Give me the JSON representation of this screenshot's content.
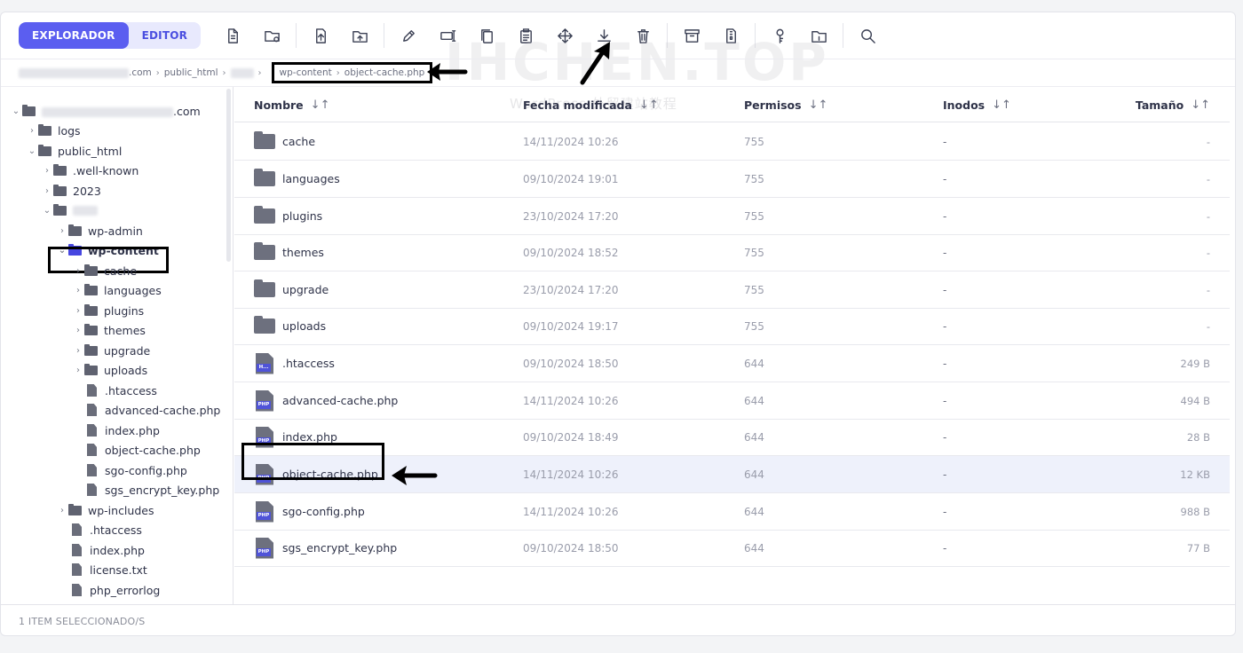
{
  "toolbar": {
    "explorer_label": "EXPLORADOR",
    "editor_label": "EDITOR",
    "tools": [
      "new-file-icon",
      "new-folder-icon",
      "upload-file-icon",
      "upload-folder-icon",
      "edit-icon",
      "rename-icon",
      "copy-icon",
      "paste-icon",
      "move-icon",
      "download-icon",
      "trash-icon",
      "archive-icon",
      "extract-icon",
      "permissions-icon",
      "folder-info-icon",
      "search-icon"
    ]
  },
  "breadcrumb": {
    "domain_suffix": ".com",
    "public_html": "public_html",
    "wp_content": "wp-content",
    "file": "object-cache.php"
  },
  "sidebar": {
    "root_suffix": ".com",
    "logs": "logs",
    "public_html": "public_html",
    "well_known": ".well-known",
    "y2023": "2023",
    "wp_admin": "wp-admin",
    "wp_content": "wp-content",
    "cache": "cache",
    "languages": "languages",
    "plugins": "plugins",
    "themes": "themes",
    "upgrade": "upgrade",
    "uploads": "uploads",
    "htaccess": ".htaccess",
    "advanced_cache": "advanced-cache.php",
    "index": "index.php",
    "object_cache": "object-cache.php",
    "sgo_config": "sgo-config.php",
    "sgs_key": "sgs_encrypt_key.php",
    "wp_includes": "wp-includes",
    "htaccess2": ".htaccess",
    "index2": "index.php",
    "license": "license.txt",
    "php_errorlog": "php_errorlog"
  },
  "table": {
    "headers": {
      "name": "Nombre",
      "date": "Fecha modificada",
      "perm": "Permisos",
      "inodes": "Inodos",
      "size": "Tamaño"
    },
    "rows": [
      {
        "name": "cache",
        "date": "14/11/2024 10:26",
        "perm": "755",
        "inodes": "-",
        "size": "-"
      },
      {
        "name": "languages",
        "date": "09/10/2024 19:01",
        "perm": "755",
        "inodes": "-",
        "size": "-"
      },
      {
        "name": "plugins",
        "date": "23/10/2024 17:20",
        "perm": "755",
        "inodes": "-",
        "size": "-"
      },
      {
        "name": "themes",
        "date": "09/10/2024 18:52",
        "perm": "755",
        "inodes": "-",
        "size": "-"
      },
      {
        "name": "upgrade",
        "date": "23/10/2024 17:20",
        "perm": "755",
        "inodes": "-",
        "size": "-"
      },
      {
        "name": "uploads",
        "date": "09/10/2024 19:17",
        "perm": "755",
        "inodes": "-",
        "size": "-"
      },
      {
        "name": ".htaccess",
        "tag": "H...",
        "date": "09/10/2024 18:50",
        "perm": "644",
        "inodes": "-",
        "size": "249 B"
      },
      {
        "name": "advanced-cache.php",
        "tag": "PHP",
        "date": "14/11/2024 10:26",
        "perm": "644",
        "inodes": "-",
        "size": "494 B"
      },
      {
        "name": "index.php",
        "tag": "PHP",
        "date": "09/10/2024 18:49",
        "perm": "644",
        "inodes": "-",
        "size": "28 B"
      },
      {
        "name": "object-cache.php",
        "tag": "PHP",
        "date": "14/11/2024 10:26",
        "perm": "644",
        "inodes": "-",
        "size": "12 KB"
      },
      {
        "name": "sgo-config.php",
        "tag": "PHP",
        "date": "14/11/2024 10:26",
        "perm": "644",
        "inodes": "-",
        "size": "988 B"
      },
      {
        "name": "sgs_encrypt_key.php",
        "tag": "PHP",
        "date": "09/10/2024 18:50",
        "perm": "644",
        "inodes": "-",
        "size": "77 B"
      }
    ]
  },
  "footer": {
    "status": "1 ITEM SELECCIONADO/S"
  },
  "watermark": {
    "main": "IHCHEN.TOP",
    "sub": "WordPress 外贸建站教程"
  },
  "colors": {
    "accent": "#5b5ef0",
    "selected_row": "#eef1fb",
    "folder_selected": "#4646e0"
  }
}
